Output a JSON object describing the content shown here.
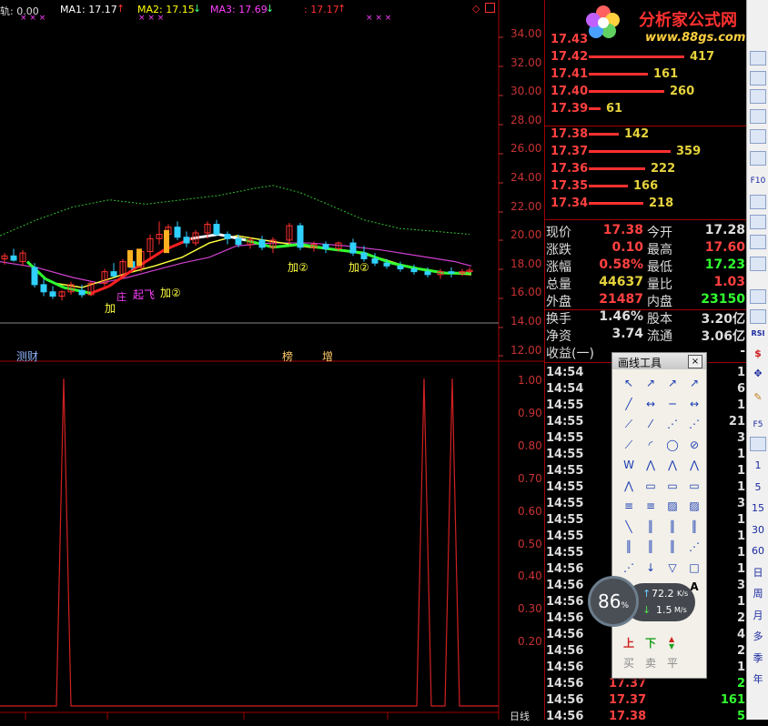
{
  "indicator_bar": {
    "prefix": "轨: 0.00",
    "ma1_label": "MA1: 17.17",
    "ma1_arrow": "↑",
    "ma2_label": "MA2: 17.15",
    "ma2_arrow": "↓",
    "ma3_label": "MA3: 17.69",
    "ma3_arrow": "↓",
    "last_label": ": 17.17",
    "last_arrow": "↑",
    "marks": "× × ×"
  },
  "price_axis": [
    "34.00",
    "32.00",
    "30.00",
    "28.00",
    "26.00",
    "24.00",
    "22.00",
    "20.00",
    "18.00",
    "16.00",
    "14.00",
    "12.00"
  ],
  "indicator_axis": [
    "1.00",
    "0.90",
    "0.80",
    "0.70",
    "0.60",
    "0.50",
    "0.40",
    "0.30",
    "0.20"
  ],
  "chart_annotations": {
    "jia": "加",
    "qifei": "起飞",
    "jia2_left": "加②",
    "jia2_mid": "加②",
    "jia2_right": "加②",
    "zhuang": "庄",
    "ce": "测",
    "cai": "财",
    "bang": "榜",
    "zeng": "增"
  },
  "chart_data": {
    "type": "line",
    "title": "",
    "panels": [
      {
        "name": "price",
        "ylim": [
          12,
          35
        ],
        "series": [
          {
            "name": "MA1",
            "color": "#ffffff"
          },
          {
            "name": "MA2",
            "color": "#ffff00"
          },
          {
            "name": "MA3",
            "color": "#ff00ff"
          }
        ]
      },
      {
        "name": "indicator",
        "ylim": [
          0,
          1.05
        ],
        "peaks": [
          {
            "position": "left",
            "value": 1.0
          },
          {
            "position": "right",
            "value": 1.0
          },
          {
            "position": "right",
            "value": 1.0
          }
        ]
      }
    ]
  },
  "watermark": {
    "title": "分析家公式网",
    "url": "www.88gs.com"
  },
  "order_book": {
    "asks": [
      {
        "price": "17.43",
        "vol": "",
        "bar": 0.0
      },
      {
        "price": "17.42",
        "vol": "417",
        "bar": 1.0
      },
      {
        "price": "17.41",
        "vol": "161",
        "bar": 0.62
      },
      {
        "price": "17.40",
        "vol": "260",
        "bar": 0.79
      },
      {
        "price": "17.39",
        "vol": "61",
        "bar": 0.12
      }
    ],
    "bids": [
      {
        "price": "17.38",
        "vol": "142",
        "bar": 0.31
      },
      {
        "price": "17.37",
        "vol": "359",
        "bar": 0.86
      },
      {
        "price": "17.36",
        "vol": "222",
        "bar": 0.59
      },
      {
        "price": "17.35",
        "vol": "166",
        "bar": 0.41
      },
      {
        "price": "17.34",
        "vol": "218",
        "bar": 0.57
      }
    ]
  },
  "quote": [
    {
      "l1": "现价",
      "v1": "17.38",
      "l2": "今开",
      "v2": "17.28"
    },
    {
      "l1": "涨跌",
      "v1": "0.10",
      "l2": "最高",
      "v2": "17.60"
    },
    {
      "l1": "涨幅",
      "v1": "0.58%",
      "l2": "最低",
      "v2": "17.23"
    },
    {
      "l1": "总量",
      "v1": "44637",
      "l2": "量比",
      "v2": "1.03"
    },
    {
      "l1": "外盘",
      "v1": "21487",
      "l2": "内盘",
      "v2": "23150"
    },
    {
      "l1": "换手",
      "v1": "1.46%",
      "l2": "股本",
      "v2": "3.20亿"
    },
    {
      "l1": "净资",
      "v1": "3.74",
      "l2": "流通",
      "v2": "3.06亿"
    },
    {
      "l1": "收益(一)",
      "v1": "",
      "l2": "",
      "v2": "-"
    }
  ],
  "ticks": [
    {
      "time": "14:54",
      "price": "",
      "vol": "1"
    },
    {
      "time": "14:54",
      "price": "",
      "vol": "6"
    },
    {
      "time": "14:55",
      "price": "",
      "vol": "1"
    },
    {
      "time": "14:55",
      "price": "",
      "vol": "21"
    },
    {
      "time": "14:55",
      "price": "",
      "vol": "3"
    },
    {
      "time": "14:55",
      "price": "",
      "vol": "1"
    },
    {
      "time": "14:55",
      "price": "",
      "vol": "1"
    },
    {
      "time": "14:55",
      "price": "",
      "vol": "1"
    },
    {
      "time": "14:55",
      "price": "",
      "vol": "3"
    },
    {
      "time": "14:55",
      "price": "",
      "vol": "1"
    },
    {
      "time": "14:55",
      "price": "",
      "vol": "1"
    },
    {
      "time": "14:55",
      "price": "",
      "vol": "1"
    },
    {
      "time": "14:56",
      "price": "",
      "vol": "1"
    },
    {
      "time": "14:56",
      "price": "",
      "vol": "3"
    },
    {
      "time": "14:56",
      "price": "",
      "vol": "1"
    },
    {
      "time": "14:56",
      "price": "",
      "vol": "2"
    },
    {
      "time": "14:56",
      "price": "",
      "vol": "4"
    },
    {
      "time": "14:56",
      "price": "",
      "vol": "2"
    },
    {
      "time": "14:56",
      "price": "",
      "vol": "1"
    },
    {
      "time": "14:56",
      "price": "17.37",
      "vol": "2"
    },
    {
      "time": "14:56",
      "price": "17.37",
      "vol": "161"
    },
    {
      "time": "14:56",
      "price": "17.38",
      "vol": "5"
    }
  ],
  "palette": {
    "title": "画线工具",
    "close": "×",
    "buy": "买",
    "sell": "卖",
    "flat": "平",
    "up_label": "上",
    "down_label": "下",
    "text_tool": "A"
  },
  "net_widget": {
    "percent": "86",
    "percent_unit": "%",
    "up": "72.2",
    "up_unit": "K/s",
    "down": "1.5",
    "down_unit": "M/s"
  },
  "toolbar": {
    "items": [
      "1",
      "5",
      "15",
      "30",
      "60",
      "日",
      "周",
      "月",
      "多",
      "季",
      "年"
    ],
    "rsi": "RSI",
    "f5": "F5",
    "f10": "F10"
  },
  "bottom": {
    "day_label": "日线"
  }
}
